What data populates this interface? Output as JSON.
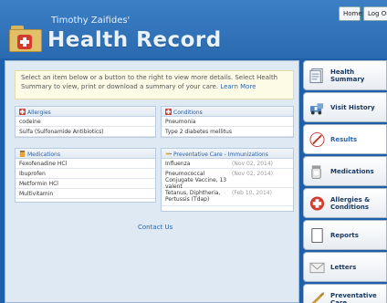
{
  "header": {
    "owner_name": "Timothy Zaifides'",
    "title": "Health Record",
    "home_label": "Home",
    "logout_label": "Log Out"
  },
  "intro": {
    "text": "Select an item below or a button to the right to view more details. Select Health Summary to view, print or download a summary of your care.",
    "link_label": "Learn More"
  },
  "allergies": {
    "title": "Allergies",
    "items": [
      "codeine",
      "Sulfa (Sulfonamide Antibiotics)"
    ]
  },
  "conditions": {
    "title": "Conditions",
    "items": [
      "Pneumonia",
      "Type 2 diabetes mellitus"
    ]
  },
  "medications": {
    "title": "Medications",
    "items": [
      "Fexofenadine HCl",
      "Ibuprofen",
      "Metformin HCl",
      "Multivitamin"
    ]
  },
  "preventive": {
    "title": "Preventative Care - Immunizations",
    "items": [
      {
        "name": "Influenza",
        "date": "(Nov 02, 2014)"
      },
      {
        "name": "Pneumococcal Conjugate Vaccine, 13 valent",
        "date": "(Nov 02, 2014)"
      },
      {
        "name": "Tetanus, Diphtheria, Pertussis (Tdap)",
        "date": "(Feb 10, 2014)"
      }
    ]
  },
  "contact_label": "Contact Us",
  "nav": {
    "items": [
      {
        "label": "Health Summary",
        "icon": "health-summary-icon"
      },
      {
        "label": "Visit History",
        "icon": "visit-history-icon"
      },
      {
        "label": "Results",
        "icon": "results-icon"
      },
      {
        "label": "Medications",
        "icon": "medications-icon"
      },
      {
        "label": "Allergies & Conditions",
        "icon": "allergies-icon"
      },
      {
        "label": "Reports",
        "icon": "reports-icon"
      },
      {
        "label": "Letters",
        "icon": "letters-icon"
      },
      {
        "label": "Preventative Care",
        "icon": "preventative-care-icon"
      }
    ]
  },
  "colors": {
    "header_blue": "#2a6ab0",
    "link_blue": "#2a64ad",
    "panel_bg": "#dfe9f4"
  }
}
